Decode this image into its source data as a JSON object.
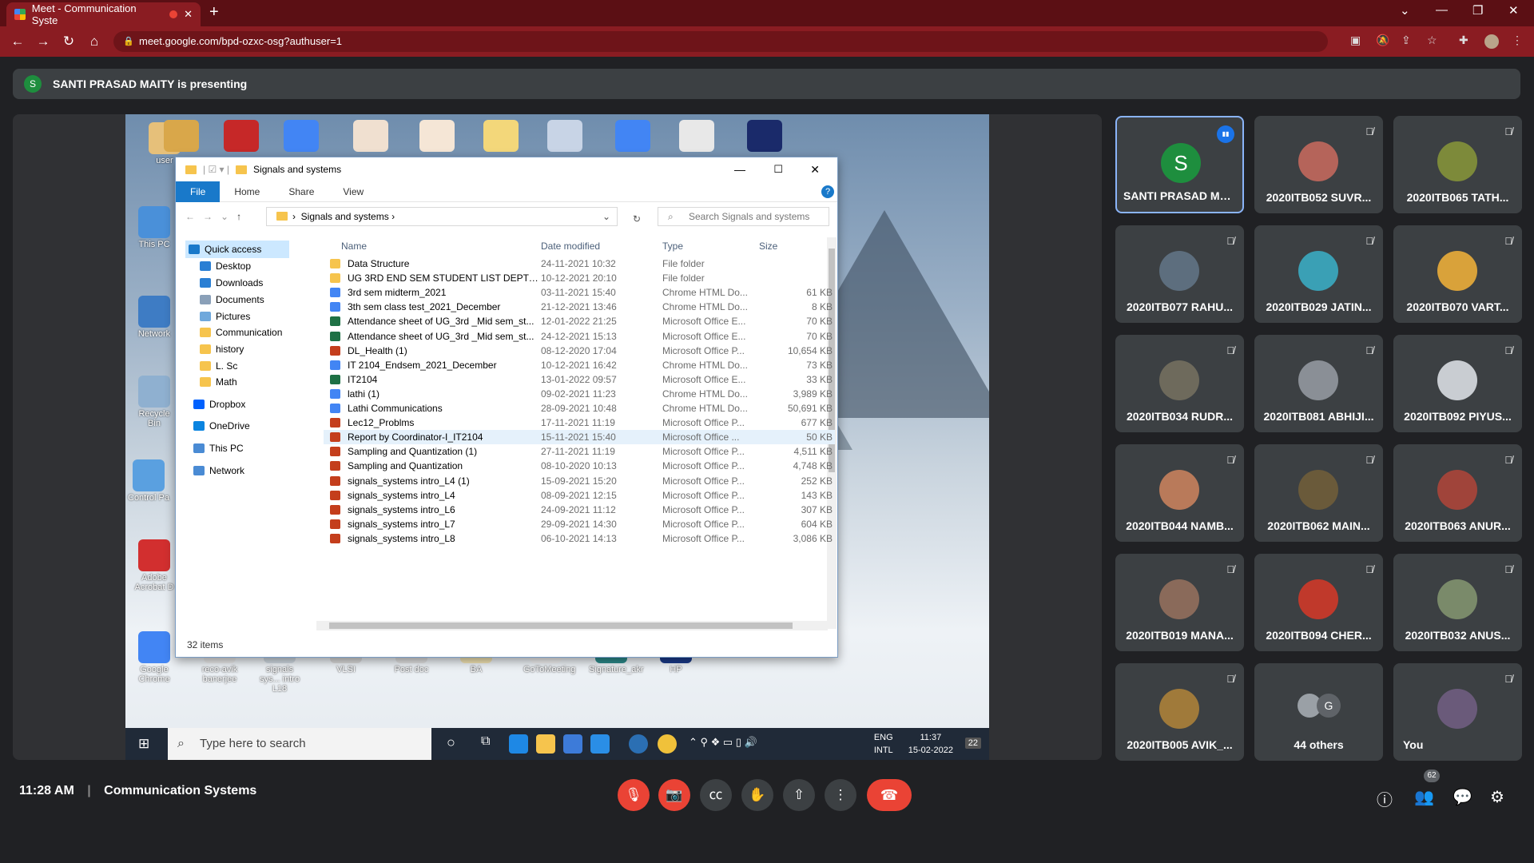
{
  "browser": {
    "tab_title": "Meet - Communication Syste",
    "url": "meet.google.com/bpd-ozxc-osg?authuser=1"
  },
  "presenter": {
    "initial": "S",
    "banner": "SANTI PRASAD MAITY is presenting"
  },
  "desktop_icons": [
    "user",
    "This PC",
    "Network",
    "Recycle Bin",
    "Control Pa",
    "Adobe Acrobat D",
    "Google Chrome",
    "reco-avik banerjee",
    "signals sys... intro L18",
    "VLSI",
    "Post doc",
    "BA",
    "GoToMeeting",
    "Signature_akr",
    "HP"
  ],
  "explorer": {
    "title": "Signals and systems",
    "ribbon": [
      "File",
      "Home",
      "Share",
      "View"
    ],
    "crumb": "Signals and systems",
    "search_placeholder": "Search Signals and systems",
    "nav": [
      "Quick access",
      "Desktop",
      "Downloads",
      "Documents",
      "Pictures",
      "Communication",
      "history",
      "L. Sc",
      "Math",
      "Dropbox",
      "OneDrive",
      "This PC",
      "Network"
    ],
    "columns": [
      "Name",
      "Date modified",
      "Type",
      "Size"
    ],
    "files": [
      {
        "name": "Data Structure",
        "date": "24-11-2021 10:32",
        "type": "File folder",
        "size": ""
      },
      {
        "name": "UG 3RD END SEM STUDENT LIST DEPT WI...",
        "date": "10-12-2021 20:10",
        "type": "File folder",
        "size": ""
      },
      {
        "name": "3rd sem midterm_2021",
        "date": "03-11-2021 15:40",
        "type": "Chrome HTML Do...",
        "size": "61 KB"
      },
      {
        "name": "3th sem class test_2021_December",
        "date": "21-12-2021 13:46",
        "type": "Chrome HTML Do...",
        "size": "8 KB"
      },
      {
        "name": "Attendance sheet of UG_3rd _Mid sem_st...",
        "date": "12-01-2022 21:25",
        "type": "Microsoft Office E...",
        "size": "70 KB"
      },
      {
        "name": "Attendance sheet of UG_3rd _Mid sem_st...",
        "date": "24-12-2021 15:13",
        "type": "Microsoft Office E...",
        "size": "70 KB"
      },
      {
        "name": "DL_Health (1)",
        "date": "08-12-2020 17:04",
        "type": "Microsoft Office P...",
        "size": "10,654 KB"
      },
      {
        "name": "IT 2104_Endsem_2021_December",
        "date": "10-12-2021 16:42",
        "type": "Chrome HTML Do...",
        "size": "73 KB"
      },
      {
        "name": "IT2104",
        "date": "13-01-2022 09:57",
        "type": "Microsoft Office E...",
        "size": "33 KB"
      },
      {
        "name": "lathi (1)",
        "date": "09-02-2021 11:23",
        "type": "Chrome HTML Do...",
        "size": "3,989 KB"
      },
      {
        "name": "Lathi Communications",
        "date": "28-09-2021 10:48",
        "type": "Chrome HTML Do...",
        "size": "50,691 KB"
      },
      {
        "name": "Lec12_Problms",
        "date": "17-11-2021 11:19",
        "type": "Microsoft Office P...",
        "size": "677 KB"
      },
      {
        "name": "Report by Coordinator-I_IT2104",
        "date": "15-11-2021 15:40",
        "type": "Microsoft Office ...",
        "size": "50 KB"
      },
      {
        "name": "Sampling and Quantization (1)",
        "date": "27-11-2021 11:19",
        "type": "Microsoft Office P...",
        "size": "4,511 KB"
      },
      {
        "name": "Sampling and Quantization",
        "date": "08-10-2020 10:13",
        "type": "Microsoft Office P...",
        "size": "4,748 KB"
      },
      {
        "name": "signals_systems intro_L4 (1)",
        "date": "15-09-2021 15:20",
        "type": "Microsoft Office P...",
        "size": "252 KB"
      },
      {
        "name": "signals_systems intro_L4",
        "date": "08-09-2021 12:15",
        "type": "Microsoft Office P...",
        "size": "143 KB"
      },
      {
        "name": "signals_systems intro_L6",
        "date": "24-09-2021 11:12",
        "type": "Microsoft Office P...",
        "size": "307 KB"
      },
      {
        "name": "signals_systems intro_L7",
        "date": "29-09-2021 14:30",
        "type": "Microsoft Office P...",
        "size": "604 KB"
      },
      {
        "name": "signals_systems intro_L8",
        "date": "06-10-2021 14:13",
        "type": "Microsoft Office P...",
        "size": "3,086 KB"
      }
    ],
    "status": "32 items"
  },
  "win_taskbar": {
    "search": "Type here to search",
    "lang1": "ENG",
    "lang2": "INTL",
    "time": "11:37",
    "date": "15-02-2022",
    "notif": "22"
  },
  "participants": [
    {
      "name": "SANTI PRASAD MA...",
      "initial": "S",
      "color": "#1e8e3e",
      "speaking": true
    },
    {
      "name": "2020ITB052 SUVR...",
      "color": "#b5645a"
    },
    {
      "name": "2020ITB065 TATH...",
      "color": "#7d8a3a"
    },
    {
      "name": "2020ITB077 RAHU...",
      "color": "#5d6e7e"
    },
    {
      "name": "2020ITB029 JATIN...",
      "color": "#3aa0b5"
    },
    {
      "name": "2020ITB070 VART...",
      "color": "#d9a23a"
    },
    {
      "name": "2020ITB034 RUDR...",
      "color": "#6e6a5c"
    },
    {
      "name": "2020ITB081 ABHIJI...",
      "color": "#8a8f96"
    },
    {
      "name": "2020ITB092 PIYUS...",
      "color": "#c9cdd2"
    },
    {
      "name": "2020ITB044 NAMB...",
      "color": "#b97a5a"
    },
    {
      "name": "2020ITB062 MAIN...",
      "color": "#6a5a3a"
    },
    {
      "name": "2020ITB063 ANUR...",
      "color": "#a0443a"
    },
    {
      "name": "2020ITB019 MANA...",
      "color": "#8a6a5a"
    },
    {
      "name": "2020ITB094 CHER...",
      "color": "#c0392b"
    },
    {
      "name": "2020ITB032 ANUS...",
      "color": "#7a8a6a"
    },
    {
      "name": "2020ITB005 AVIK_...",
      "color": "#a07a3a"
    },
    {
      "name": "44 others",
      "others": true
    },
    {
      "name": "You",
      "color": "#6a5a7a"
    }
  ],
  "others_initial": "G",
  "bottom": {
    "time": "11:28 AM",
    "meeting": "Communication Systems",
    "people_count": "62"
  }
}
